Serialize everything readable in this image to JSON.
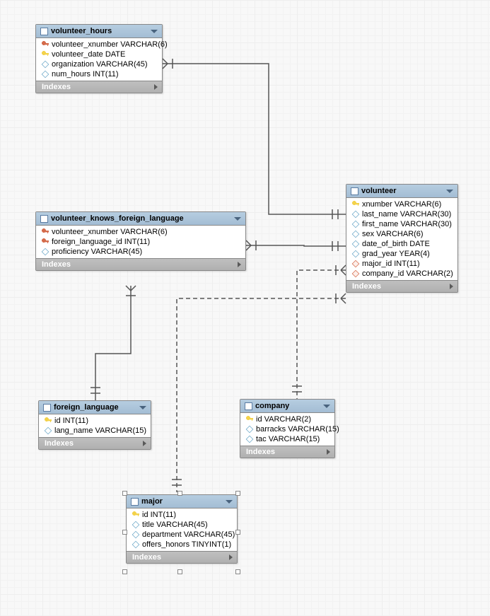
{
  "tables": {
    "volunteer_hours": {
      "title": "volunteer_hours",
      "indexes_label": "Indexes",
      "cols": [
        {
          "icon": "fk",
          "label": "volunteer_xnumber VARCHAR(6)"
        },
        {
          "icon": "pk",
          "label": "volunteer_date DATE"
        },
        {
          "icon": "attr",
          "label": "organization VARCHAR(45)"
        },
        {
          "icon": "attr",
          "label": "num_hours INT(11)"
        }
      ]
    },
    "volunteer_knows_foreign_language": {
      "title": "volunteer_knows_foreign_language",
      "indexes_label": "Indexes",
      "cols": [
        {
          "icon": "fk",
          "label": "volunteer_xnumber VARCHAR(6)"
        },
        {
          "icon": "fk",
          "label": "foreign_language_id INT(11)"
        },
        {
          "icon": "attr",
          "label": "proficiency VARCHAR(45)"
        }
      ]
    },
    "volunteer": {
      "title": "volunteer",
      "indexes_label": "Indexes",
      "cols": [
        {
          "icon": "pk",
          "label": "xnumber VARCHAR(6)"
        },
        {
          "icon": "attr",
          "label": "last_name VARCHAR(30)"
        },
        {
          "icon": "attr",
          "label": "first_name VARCHAR(30)"
        },
        {
          "icon": "attr",
          "label": "sex VARCHAR(6)"
        },
        {
          "icon": "attr",
          "label": "date_of_birth DATE"
        },
        {
          "icon": "attr",
          "label": "grad_year YEAR(4)"
        },
        {
          "icon": "fkd",
          "label": "major_id INT(11)"
        },
        {
          "icon": "fkd",
          "label": "company_id VARCHAR(2)"
        }
      ]
    },
    "foreign_language": {
      "title": "foreign_language",
      "indexes_label": "Indexes",
      "cols": [
        {
          "icon": "pk",
          "label": "id INT(11)"
        },
        {
          "icon": "attr",
          "label": "lang_name VARCHAR(15)"
        }
      ]
    },
    "company": {
      "title": "company",
      "indexes_label": "Indexes",
      "cols": [
        {
          "icon": "pk",
          "label": "id VARCHAR(2)"
        },
        {
          "icon": "attr",
          "label": "barracks VARCHAR(15)"
        },
        {
          "icon": "attr",
          "label": "tac VARCHAR(15)"
        }
      ]
    },
    "major": {
      "title": "major",
      "indexes_label": "Indexes",
      "cols": [
        {
          "icon": "pk",
          "label": "id INT(11)"
        },
        {
          "icon": "attr",
          "label": "title VARCHAR(45)"
        },
        {
          "icon": "attr",
          "label": "department VARCHAR(45)"
        },
        {
          "icon": "attr",
          "label": "offers_honors TINYINT(1)"
        }
      ]
    }
  },
  "relationships": [
    {
      "from": "volunteer_hours",
      "to": "volunteer",
      "type": "identifying"
    },
    {
      "from": "volunteer_knows_foreign_language",
      "to": "volunteer",
      "type": "identifying"
    },
    {
      "from": "volunteer_knows_foreign_language",
      "to": "foreign_language",
      "type": "identifying"
    },
    {
      "from": "volunteer",
      "to": "company",
      "type": "non-identifying"
    },
    {
      "from": "volunteer",
      "to": "major",
      "type": "non-identifying"
    }
  ],
  "diagram_meta": {
    "selected_table": "major",
    "grid": true
  },
  "chart_data": {
    "type": "er-diagram",
    "entities": [
      {
        "name": "volunteer_hours",
        "attributes": [
          "volunteer_xnumber VARCHAR(6)",
          "volunteer_date DATE",
          "organization VARCHAR(45)",
          "num_hours INT(11)"
        ],
        "pk": [
          "volunteer_xnumber",
          "volunteer_date"
        ]
      },
      {
        "name": "volunteer_knows_foreign_language",
        "attributes": [
          "volunteer_xnumber VARCHAR(6)",
          "foreign_language_id INT(11)",
          "proficiency VARCHAR(45)"
        ],
        "pk": [
          "volunteer_xnumber",
          "foreign_language_id"
        ]
      },
      {
        "name": "volunteer",
        "attributes": [
          "xnumber VARCHAR(6)",
          "last_name VARCHAR(30)",
          "first_name VARCHAR(30)",
          "sex VARCHAR(6)",
          "date_of_birth DATE",
          "grad_year YEAR(4)",
          "major_id INT(11)",
          "company_id VARCHAR(2)"
        ],
        "pk": [
          "xnumber"
        ]
      },
      {
        "name": "foreign_language",
        "attributes": [
          "id INT(11)",
          "lang_name VARCHAR(15)"
        ],
        "pk": [
          "id"
        ]
      },
      {
        "name": "company",
        "attributes": [
          "id VARCHAR(2)",
          "barracks VARCHAR(15)",
          "tac VARCHAR(15)"
        ],
        "pk": [
          "id"
        ]
      },
      {
        "name": "major",
        "attributes": [
          "id INT(11)",
          "title VARCHAR(45)",
          "department VARCHAR(45)",
          "offers_honors TINYINT(1)"
        ],
        "pk": [
          "id"
        ]
      }
    ],
    "relationships": [
      {
        "child": "volunteer_hours",
        "parent": "volunteer",
        "identifying": true,
        "cardinality": "many-to-one"
      },
      {
        "child": "volunteer_knows_foreign_language",
        "parent": "volunteer",
        "identifying": true,
        "cardinality": "many-to-one"
      },
      {
        "child": "volunteer_knows_foreign_language",
        "parent": "foreign_language",
        "identifying": true,
        "cardinality": "many-to-one"
      },
      {
        "child": "volunteer",
        "parent": "company",
        "identifying": false,
        "cardinality": "many-to-one"
      },
      {
        "child": "volunteer",
        "parent": "major",
        "identifying": false,
        "cardinality": "many-to-one"
      }
    ]
  }
}
